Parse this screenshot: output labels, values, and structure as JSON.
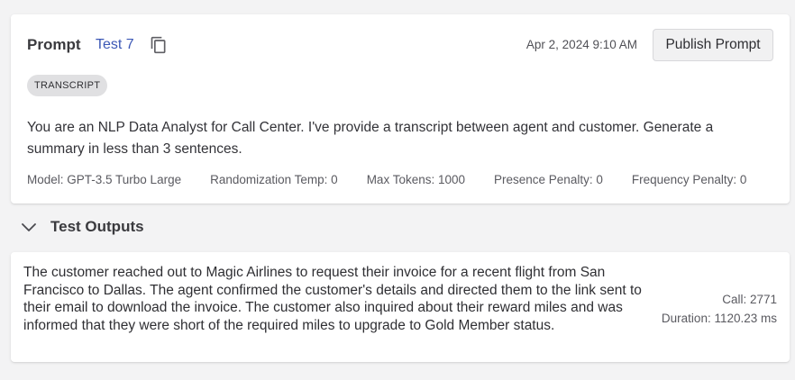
{
  "prompt": {
    "label": "Prompt",
    "test_name": "Test 7",
    "timestamp": "Apr 2, 2024 9:10 AM",
    "publish_label": "Publish Prompt",
    "tag": "TRANSCRIPT",
    "text": "You are an NLP Data Analyst for Call Center. I've provide a transcript between agent and customer. Generate a summary in less than 3 sentences.",
    "params": {
      "model": "Model: GPT-3.5 Turbo Large",
      "temperature": "Randomization Temp: 0",
      "max_tokens": "Max Tokens: 1000",
      "presence_penalty": "Presence Penalty: 0",
      "frequency_penalty": "Frequency Penalty: 0"
    }
  },
  "outputs": {
    "title": "Test Outputs",
    "items": [
      {
        "text": "The customer reached out to Magic Airlines to request their invoice for a recent flight from San Francisco to Dallas. The agent confirmed the customer's details and directed them to the link sent to their email to download the invoice. The customer also inquired about their reward miles and was informed that they were short of the required miles to upgrade to Gold Member status.",
        "call": "Call: 2771",
        "duration": "Duration: 1120.23 ms"
      }
    ]
  },
  "icons": {
    "copy": "copy-icon",
    "chevron": "chevron-down-icon"
  },
  "colors": {
    "link": "#3b57b5",
    "background": "#f3f3f4",
    "chip": "#e0e0e2"
  }
}
